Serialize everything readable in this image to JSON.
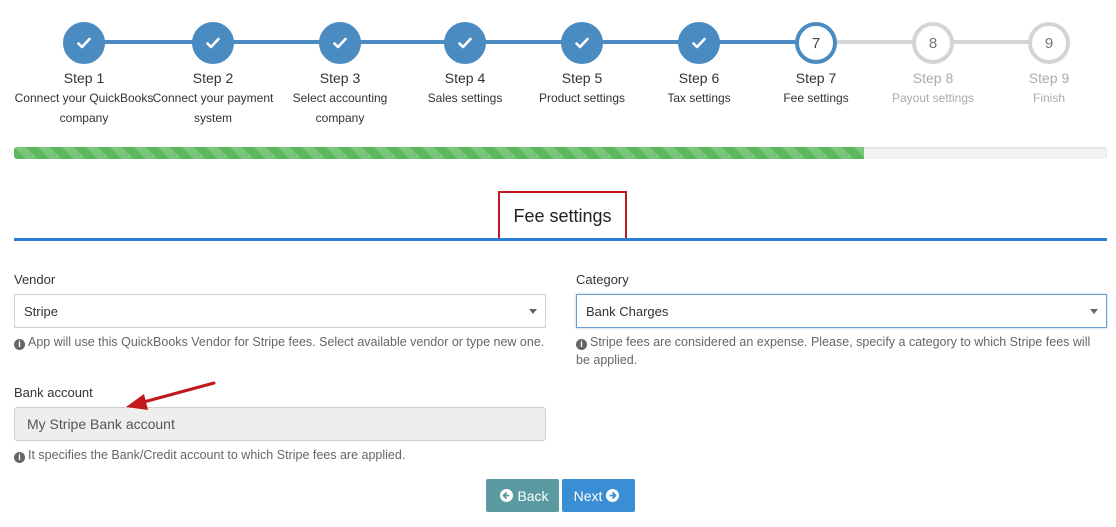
{
  "stepper": {
    "steps": [
      {
        "title": "Step 1",
        "desc": "Connect your QuickBooks company",
        "state": "done"
      },
      {
        "title": "Step 2",
        "desc": "Connect your payment system",
        "state": "done"
      },
      {
        "title": "Step 3",
        "desc": "Select accounting company",
        "state": "done"
      },
      {
        "title": "Step 4",
        "desc": "Sales settings",
        "state": "done"
      },
      {
        "title": "Step 5",
        "desc": "Product settings",
        "state": "done"
      },
      {
        "title": "Step 6",
        "desc": "Tax settings",
        "state": "done"
      },
      {
        "title": "Step 7",
        "desc": "Fee settings",
        "state": "current",
        "number": "7"
      },
      {
        "title": "Step 8",
        "desc": "Payout settings",
        "state": "todo",
        "number": "8"
      },
      {
        "title": "Step 9",
        "desc": "Finish",
        "state": "todo",
        "number": "9"
      }
    ],
    "colors": {
      "done": "#4a8bc2",
      "todo": "#d4d4d4"
    }
  },
  "progress": {
    "fraction": 0.778,
    "color": "#5cb85c"
  },
  "section": {
    "title": "Fee settings",
    "highlight_color": "#c0181d"
  },
  "form": {
    "vendor": {
      "label": "Vendor",
      "value": "Stripe",
      "help": "App will use this QuickBooks Vendor for Stripe fees. Select available vendor or type new one."
    },
    "category": {
      "label": "Category",
      "value": "Bank Charges",
      "help": "Stripe fees are considered an expense. Please, specify a category to which Stripe fees will be applied."
    },
    "bank_account": {
      "label": "Bank account",
      "value": "My Stripe Bank account",
      "help": "It specifies the Bank/Credit account to which Stripe fees are applied."
    }
  },
  "buttons": {
    "back": "Back",
    "next": "Next"
  },
  "annotation": {
    "arrow_color": "#c0181d"
  }
}
